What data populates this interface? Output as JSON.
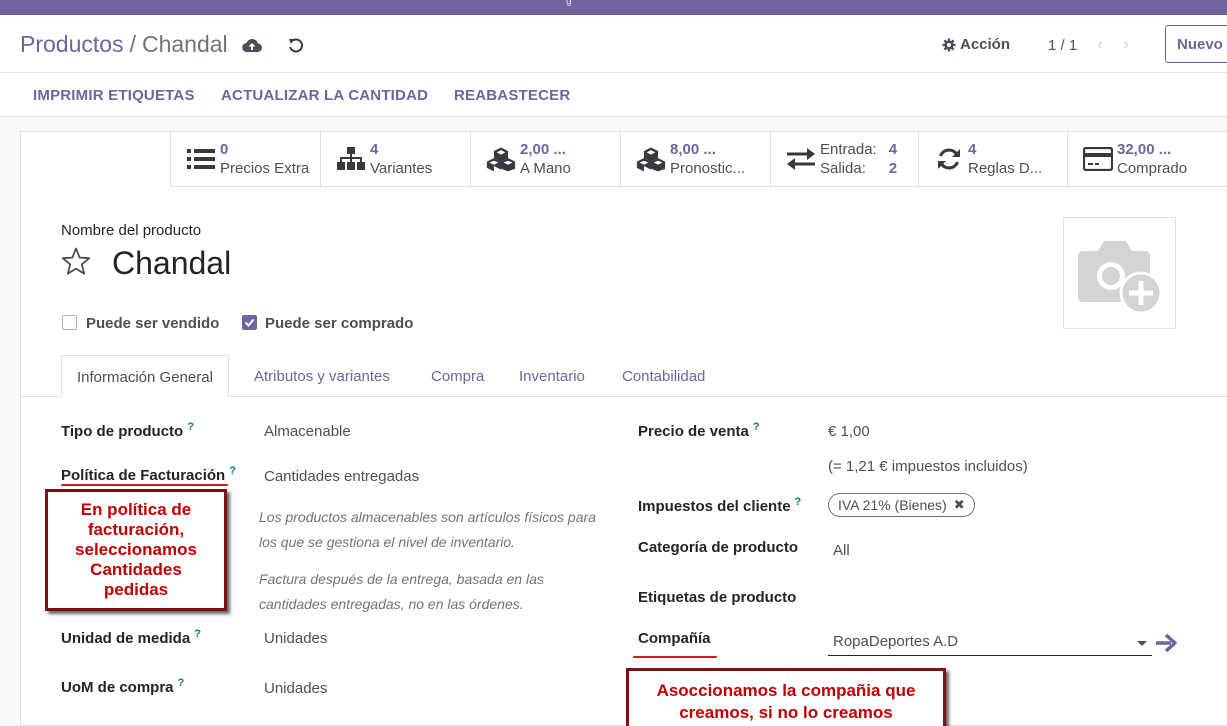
{
  "topbar": {
    "mark": "g"
  },
  "breadcrumb": {
    "parent": "Productos",
    "separator": "/",
    "current": "Chandal"
  },
  "toolbar": {
    "action_label": "Acción",
    "pager": "1 / 1",
    "new_label": "Nuevo"
  },
  "status_buttons": [
    "IMPRIMIR ETIQUETAS",
    "ACTUALIZAR LA CANTIDAD",
    "REABASTECER"
  ],
  "smart_buttons": [
    {
      "value": "0",
      "label": "Precios Extra",
      "icon": "list-icon"
    },
    {
      "value": "4",
      "label": "Variantes",
      "icon": "sitemap-icon"
    },
    {
      "value": "2,00 ...",
      "label": "A Mano",
      "icon": "cubes-icon"
    },
    {
      "value": "8,00 ...",
      "label": "Pronostic...",
      "icon": "cubes-icon"
    },
    {
      "in_label": "Entrada:",
      "in_value": "4",
      "out_label": "Salida:",
      "out_value": "2",
      "icon": "exchange-icon"
    },
    {
      "value": "4",
      "label": "Reglas D...",
      "icon": "refresh-icon"
    },
    {
      "value": "32,00 ...",
      "label": "Comprado",
      "icon": "credit-card-icon"
    }
  ],
  "product": {
    "name_label": "Nombre del producto",
    "name": "Chandal",
    "can_be_sold_label": "Puede ser vendido",
    "can_be_sold": false,
    "can_be_purchased_label": "Puede ser comprado",
    "can_be_purchased": true
  },
  "tabs": [
    "Información General",
    "Atributos y variantes",
    "Compra",
    "Inventario",
    "Contabilidad"
  ],
  "general": {
    "type_label": "Tipo de producto",
    "type_value": "Almacenable",
    "invoice_policy_label": "Política de Facturación",
    "invoice_policy_value": "Cantidades entregadas",
    "help1": "Los productos almacenables son artículos físicos para los que se gestiona el nivel de inventario.",
    "help2": "Factura después de la entrega, basada en las cantidades entregadas, no en las órdenes.",
    "uom_label": "Unidad de medida",
    "uom_value": "Unidades",
    "uom_po_label": "UoM de compra",
    "uom_po_value": "Unidades",
    "sale_price_label": "Precio de venta",
    "sale_price_value": "€ 1,00",
    "sale_price_taxed": "(= 1,21 € impuestos incluidos)",
    "customer_taxes_label": "Impuestos del cliente",
    "customer_tax_tag": "IVA 21% (Bienes)",
    "category_label": "Categoría de producto",
    "category_value": "All",
    "tags_label": "Etiquetas de producto",
    "company_label": "Compañía",
    "company_value": "RopaDeportes A.D"
  },
  "annotations": {
    "note1": [
      "En política de",
      "facturación,",
      "seleccionamos",
      "Cantidades",
      "pedidas"
    ],
    "note2": [
      "Asoccionamos la compañia que",
      "creamos, si no lo creamos"
    ]
  },
  "colors": {
    "brand": "#71639e",
    "annotation_red": "#c00000"
  }
}
